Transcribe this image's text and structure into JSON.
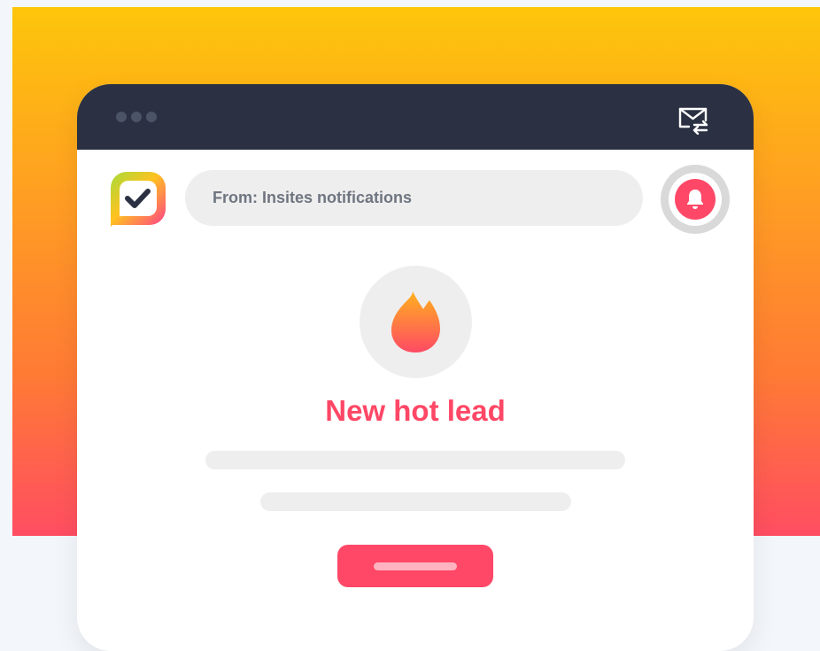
{
  "colors": {
    "accent": "#ff4867",
    "titlebar": "#2b3142",
    "gradient_top": "#fdc60a",
    "gradient_bottom": "#ff4d62"
  },
  "titlebar": {
    "icons": [
      "window-dots-icon",
      "mail-transfer-icon"
    ]
  },
  "sender": {
    "logo": "insites-check-logo-icon",
    "from_text": "From: Insites notifications",
    "bell": "bell-icon"
  },
  "notification": {
    "icon": "fire-icon",
    "headline": "New hot lead"
  }
}
